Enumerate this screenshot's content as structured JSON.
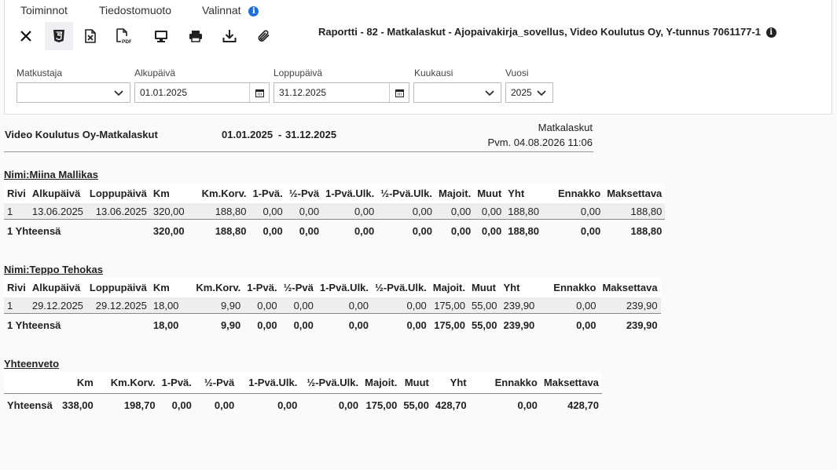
{
  "menu": {
    "toiminnot": "Toiminnot",
    "tiedostomuoto": "Tiedostomuoto",
    "valinnat": "Valinnat"
  },
  "toolbar": [
    "close-icon",
    "html5-icon",
    "excel-icon",
    "pdf-icon",
    "monitor-icon",
    "print-icon",
    "download-icon",
    "attach-icon"
  ],
  "report_title": "Raportti - 82 - Matkalaskut - Ajopaivakirja_sovellus, Video Koulutus Oy, Y-tunnus 7061177-1",
  "filters": {
    "matkustaja": {
      "label": "Matkustaja",
      "value": ""
    },
    "alkupaiva": {
      "label": "Alkupäivä",
      "value": "01.01.2025"
    },
    "loppupaiva": {
      "label": "Loppupäivä",
      "value": "31.12.2025"
    },
    "kuukausi": {
      "label": "Kuukausi",
      "value": ""
    },
    "vuosi": {
      "label": "Vuosi",
      "value": "2025"
    }
  },
  "report": {
    "company": "Video Koulutus Oy-Matkalaskut",
    "start": "01.01.2025",
    "sep": "-",
    "end": "31.12.2025",
    "type": "Matkalaskut",
    "printed": "Pvm. 04.08.2026 11:06"
  },
  "columns": [
    "Rivi",
    "Alkupäivä",
    "Loppupäivä",
    "Km",
    "Km.Korv.",
    "1-Pvä.",
    "½-Pvä",
    "1-Pvä.Ulk.",
    "½-Pvä.Ulk.",
    "Majoit.",
    "Muut",
    "Yht",
    "Ennakko",
    "Maksettava"
  ],
  "groups": [
    {
      "name": "Nimi:Miina Mallikas",
      "row": [
        "1",
        "13.06.2025",
        "13.06.2025",
        "320,00",
        "188,80",
        "0,00",
        "0,00",
        "0,00",
        "0,00",
        "0,00",
        "0,00",
        "188,80",
        "0,00",
        "188,80"
      ],
      "total": [
        "1 Yhteensä",
        "320,00",
        "188,80",
        "0,00",
        "0,00",
        "0,00",
        "0,00",
        "0,00",
        "0,00",
        "188,80",
        "0,00",
        "188,80"
      ]
    },
    {
      "name": "Nimi:Teppo Tehokas",
      "row": [
        "1",
        "29.12.2025",
        "29.12.2025",
        "18,00",
        "9,90",
        "0,00",
        "0,00",
        "0,00",
        "0,00",
        "175,00",
        "55,00",
        "239,90",
        "0,00",
        "239,90"
      ],
      "total": [
        "1 Yhteensä",
        "18,00",
        "9,90",
        "0,00",
        "0,00",
        "0,00",
        "0,00",
        "175,00",
        "55,00",
        "239,90",
        "0,00",
        "239,90"
      ]
    }
  ],
  "summary": {
    "title": "Yhteenveto",
    "columns": [
      "",
      "Km",
      "Km.Korv.",
      "1-Pvä.",
      "½-Pvä",
      "1-Pvä.Ulk.",
      "½-Pvä.Ulk.",
      "Majoit.",
      "Muut",
      "Yht",
      "Ennakko",
      "Maksettava"
    ],
    "row": [
      "Yhteensä",
      "338,00",
      "198,70",
      "0,00",
      "0,00",
      "0,00",
      "0,00",
      "175,00",
      "55,00",
      "428,70",
      "0,00",
      "428,70"
    ]
  }
}
